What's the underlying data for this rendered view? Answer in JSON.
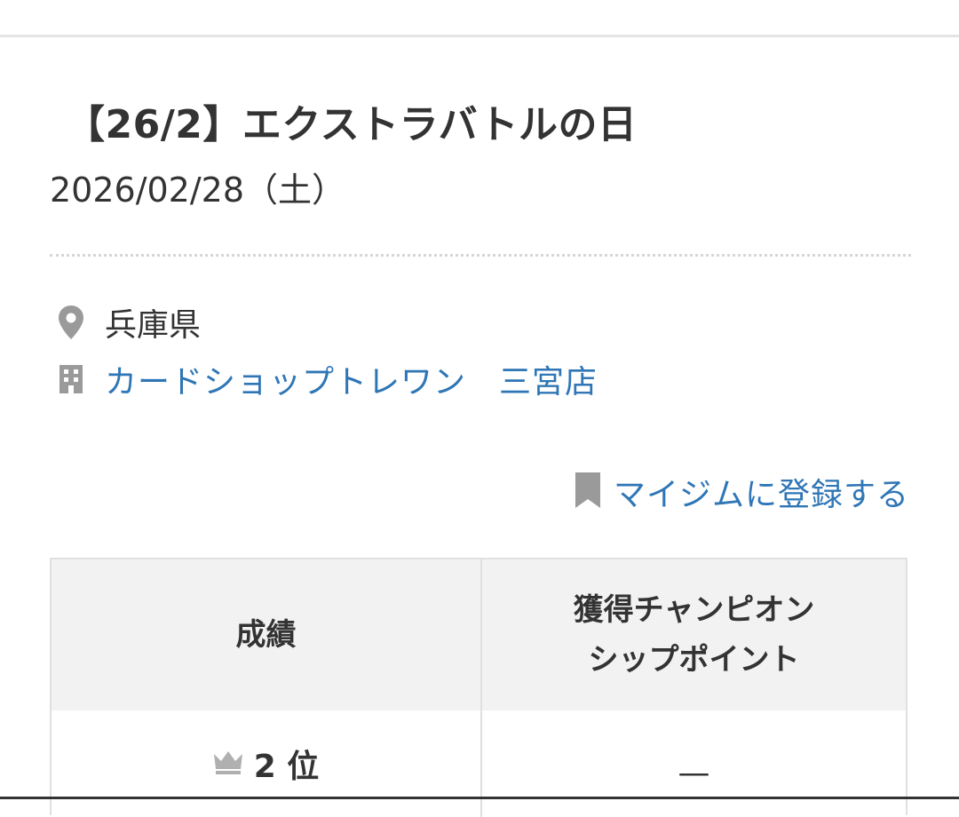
{
  "event": {
    "title": "【26/2】エクストラバトルの日",
    "date": "2026/02/28（土）"
  },
  "location": {
    "prefecture": "兵庫県",
    "shop_name": "カードショップトレワン　三宮店",
    "prefecture_icon": "map-pin-icon",
    "shop_icon": "building-icon"
  },
  "mygym": {
    "label": "マイジムに登録する",
    "icon": "bookmark-icon"
  },
  "results_table": {
    "headers": {
      "result": "成績",
      "points_line1": "獲得チャンピオン",
      "points_line2": "シップポイント"
    },
    "rows": [
      {
        "rank": "2 位",
        "rank_icon": "crown-icon",
        "points": "—"
      }
    ]
  },
  "colors": {
    "text": "#333333",
    "link": "#2f76b6",
    "icon_gray": "#9a9a9a",
    "table_header_bg": "#f2f2f2",
    "border": "#e0e0e0"
  }
}
